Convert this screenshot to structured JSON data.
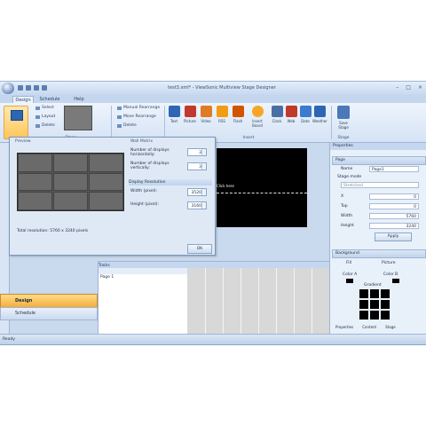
{
  "window": {
    "title": "test3.xml* - ViewSonic Multiview Stage Designer",
    "controls": [
      "–",
      "□",
      "×"
    ]
  },
  "ribbon": {
    "tabs": [
      "Design",
      "Schedule",
      "Help"
    ],
    "small_buttons": [
      "Select",
      "Layout",
      "Delete"
    ],
    "screen_buttons": [
      "Manual Rearrange",
      "Move Rearrange",
      "Delete"
    ],
    "insert_items": [
      "Text",
      "Picture",
      "Video",
      "RSS",
      "Flash",
      "Insert Board",
      "Clock",
      "Web",
      "Date",
      "Weather"
    ],
    "save_label": "Save Stage",
    "group_labels": [
      "Stage",
      "Insert",
      "Stage"
    ]
  },
  "dialog": {
    "section_left": "Preview",
    "section_right": "Wall Matrix",
    "monitors_horizontal_label": "Number of displays horizontally:",
    "monitors_horizontal_value": "3",
    "monitors_vertical_label": "Number of displays vertically:",
    "monitors_vertical_value": "3",
    "resolution_section": "Display Resolution",
    "width_label": "Width (pixel):",
    "width_value": "3520",
    "height_label": "Height (pixel):",
    "height_value": "3160",
    "note": "Total resolution: 5760 x 3240 pixels",
    "ok_label": "OK"
  },
  "preview": {
    "label": "Click here"
  },
  "properties": {
    "header": "Properties",
    "page_section": "Page",
    "name_label": "Name",
    "name_value": "Page1",
    "stage_mode_label": "Stage mode",
    "stage_mode_value": "Stretched",
    "x_label": "X",
    "x_value": "0",
    "y_label": "Top",
    "y_value": "0",
    "width_label": "Width",
    "width_value": "5760",
    "height_label": "Height",
    "height_value": "3240",
    "apply_label": "Apply",
    "background_section": "Background",
    "fill_tab": "Fill",
    "picture_tab": "Picture",
    "color_a": "Color A",
    "color_b": "Color B",
    "gradient_label": "Gradient",
    "bottom_tabs": [
      "Properties",
      "Content",
      "Stage"
    ]
  },
  "tracks": {
    "header": "Tracks",
    "row_label": "Page 1"
  },
  "navigation": {
    "design_label": "Design",
    "schedule_label": "Schedule"
  },
  "status": {
    "text": "Ready"
  },
  "colors": {
    "ribbon_bg": "#d5e3f5",
    "active_nav": "#f5ad3a",
    "stage_bg": "#000000"
  }
}
